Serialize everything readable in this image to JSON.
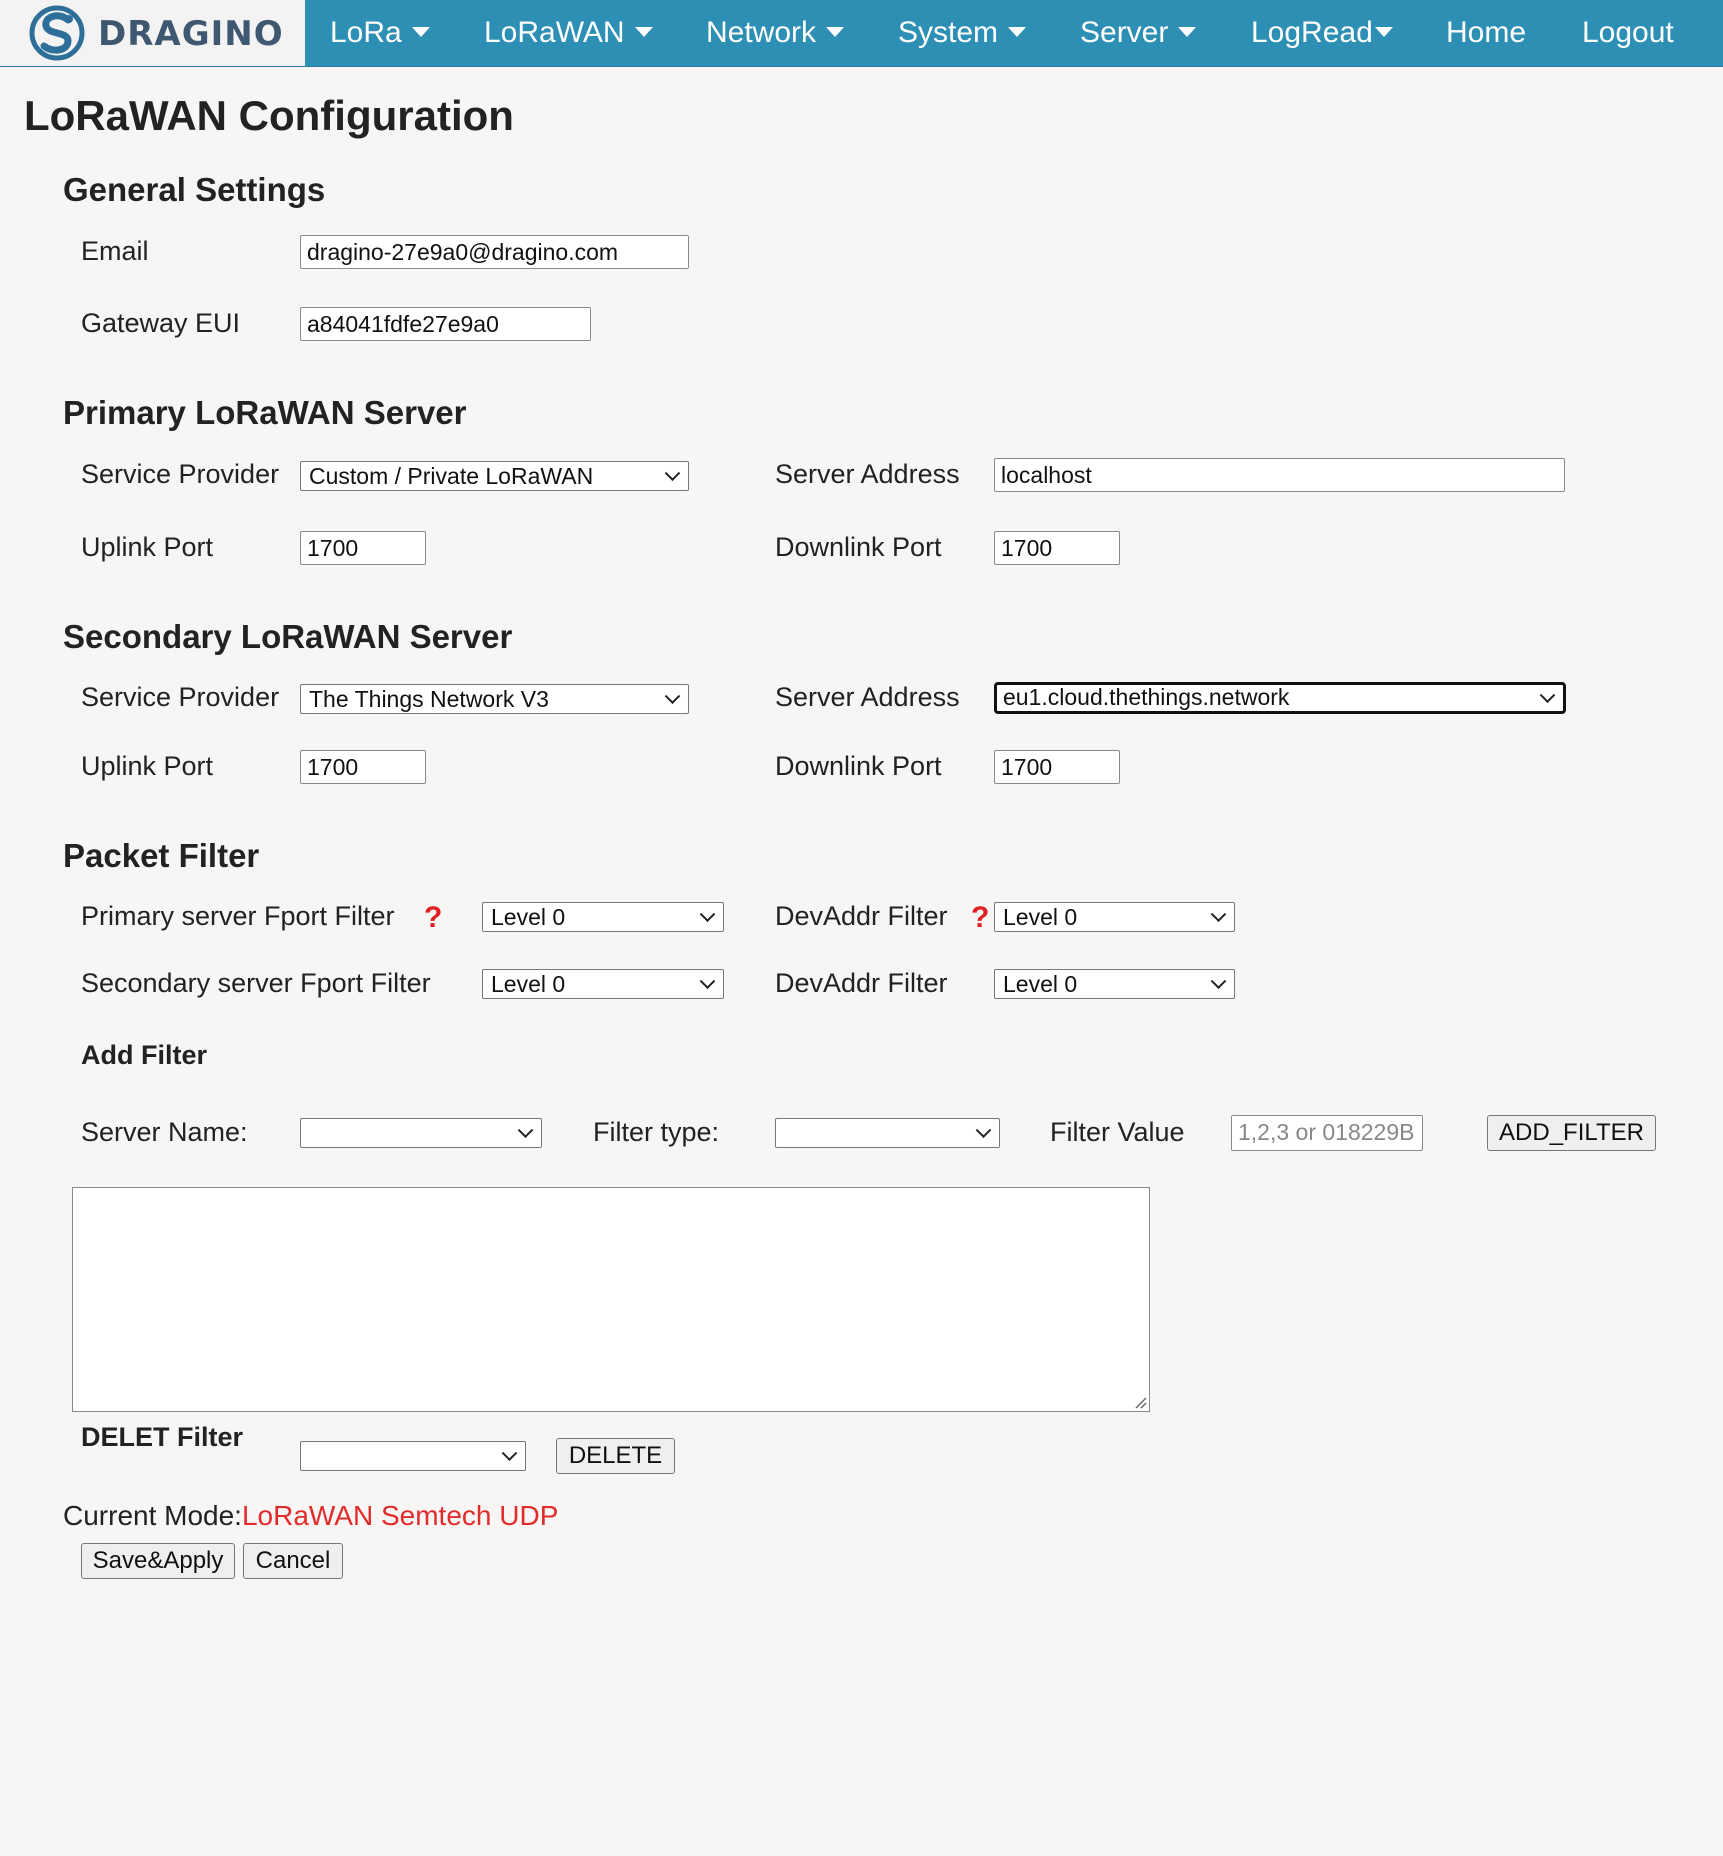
{
  "brand": {
    "name": "DRAGINO"
  },
  "nav": {
    "items": [
      {
        "label": "LoRa",
        "dropdown": true
      },
      {
        "label": "LoRaWAN",
        "dropdown": true
      },
      {
        "label": "Network",
        "dropdown": true
      },
      {
        "label": "System",
        "dropdown": true
      },
      {
        "label": "Server",
        "dropdown": true
      },
      {
        "label": "LogRead",
        "dropdown": true
      },
      {
        "label": "Home",
        "dropdown": false
      },
      {
        "label": "Logout",
        "dropdown": false
      }
    ]
  },
  "page": {
    "title": "LoRaWAN Configuration"
  },
  "general": {
    "title": "General Settings",
    "email_label": "Email",
    "email_value": "dragino-27e9a0@dragino.com",
    "eui_label": "Gateway EUI",
    "eui_value": "a84041fdfe27e9a0"
  },
  "primary": {
    "title": "Primary LoRaWAN Server",
    "provider_label": "Service Provider",
    "provider_value": "Custom / Private LoRaWAN",
    "address_label": "Server Address",
    "address_value": "localhost",
    "uplink_label": "Uplink Port",
    "uplink_value": "1700",
    "downlink_label": "Downlink Port",
    "downlink_value": "1700"
  },
  "secondary": {
    "title": "Secondary LoRaWAN Server",
    "provider_label": "Service Provider",
    "provider_value": "The Things Network V3",
    "address_label": "Server Address",
    "address_value": "eu1.cloud.thethings.network",
    "uplink_label": "Uplink Port",
    "uplink_value": "1700",
    "downlink_label": "Downlink Port",
    "downlink_value": "1700"
  },
  "packet_filter": {
    "title": "Packet Filter",
    "primary_fport_label": "Primary server Fport Filter",
    "primary_fport_value": "Level 0",
    "primary_devaddr_label": "DevAddr Filter",
    "primary_devaddr_value": "Level 0",
    "secondary_fport_label": "Secondary server Fport Filter",
    "secondary_fport_value": "Level 0",
    "secondary_devaddr_label": "DevAddr Filter",
    "secondary_devaddr_value": "Level 0",
    "help_glyph": "?"
  },
  "add_filter": {
    "title": "Add Filter",
    "server_name_label": "Server Name:",
    "server_name_value": "",
    "filter_type_label": "Filter type:",
    "filter_type_value": "",
    "filter_value_label": "Filter Value",
    "filter_value_placeholder": "1,2,3 or 018229B",
    "add_button": "ADD_FILTER"
  },
  "delete_filter": {
    "title": "DELET Filter",
    "select_value": "",
    "delete_button": "DELETE"
  },
  "mode": {
    "label": "Current Mode:",
    "value": "LoRaWAN Semtech UDP"
  },
  "actions": {
    "save": "Save&Apply",
    "cancel": "Cancel"
  },
  "colors": {
    "nav_bg": "#2e8fb5",
    "mode_value": "#e22b2b",
    "help": "#e02020"
  }
}
